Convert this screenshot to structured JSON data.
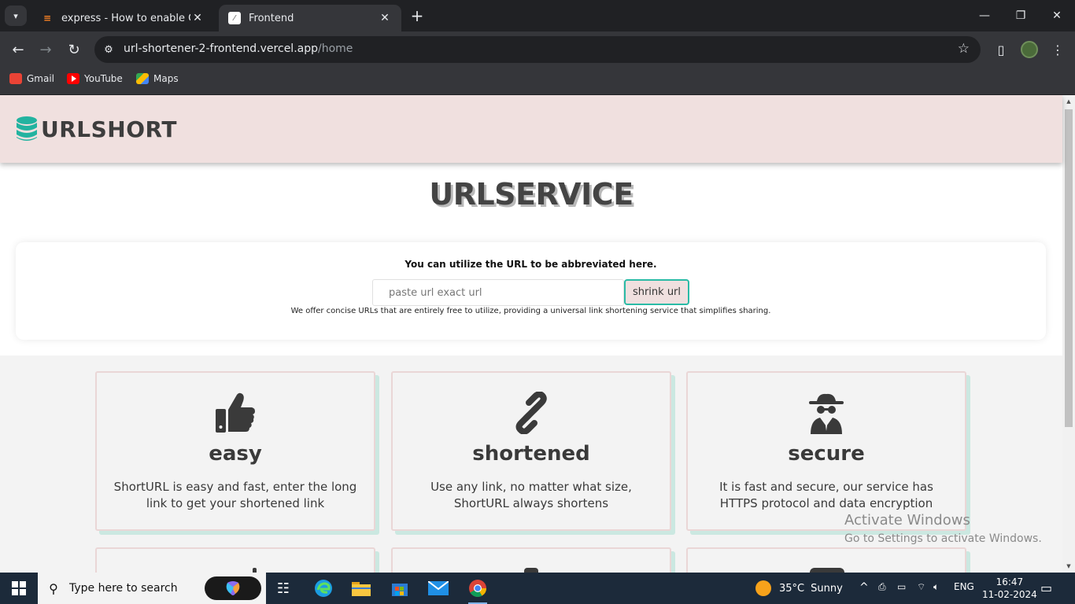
{
  "browser": {
    "tabs": [
      {
        "title": "express - How to enable CORS i",
        "active": false
      },
      {
        "title": "Frontend",
        "active": true
      }
    ],
    "url_host": "url-shortener-2-frontend.vercel.app",
    "url_path": "/home",
    "bookmarks": [
      {
        "label": "Gmail",
        "icon": "gmail-icon"
      },
      {
        "label": "YouTube",
        "icon": "youtube-icon"
      },
      {
        "label": "Maps",
        "icon": "maps-icon"
      }
    ]
  },
  "site": {
    "logo_text": "URLSHORT",
    "hero_title": "URLSERVICE",
    "card_heading": "You can utilize the URL to be abbreviated here.",
    "input_placeholder": "paste url exact url",
    "shrink_label": "shrink url",
    "card_sub": "We offer concise URLs that are entirely free to utilize, providing a universal link shortening service that simplifies sharing.",
    "features": [
      {
        "icon": "thumbs-up-icon",
        "title": "easy",
        "desc": "ShortURL is easy and fast, enter the long link to get your shortened link"
      },
      {
        "icon": "link-icon",
        "title": "shortened",
        "desc": "Use any link, no matter what size, ShortURL always shortens"
      },
      {
        "icon": "spy-icon",
        "title": "secure",
        "desc": "It is fast and secure, our service has HTTPS protocol and data encryption"
      }
    ],
    "accent": "#2bbba6",
    "header_bg": "#f0e0df"
  },
  "watermark": {
    "line1": "Activate Windows",
    "line2": "Go to Settings to activate Windows."
  },
  "taskbar": {
    "search_placeholder": "Type here to search",
    "temperature": "35°C",
    "condition": "Sunny",
    "language": "ENG",
    "time": "16:47",
    "date": "11-02-2024"
  }
}
